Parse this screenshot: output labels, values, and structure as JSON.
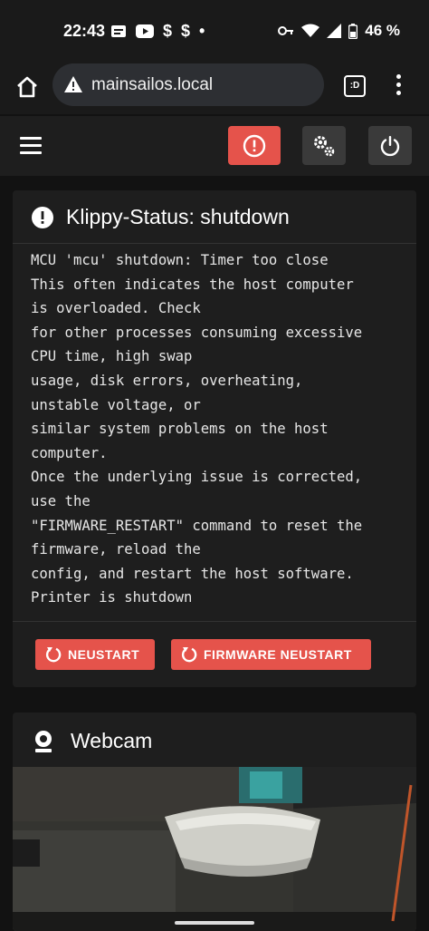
{
  "statusbar": {
    "time": "22:43",
    "battery": "46 %",
    "dollar1": "$",
    "dollar2": "$",
    "dot": "•"
  },
  "browser": {
    "url": "mainsailos.local",
    "tabs_label": ":D"
  },
  "klippy": {
    "title": "Klippy-Status: shutdown",
    "message_lines": [
      "MCU 'mcu' shutdown: Timer too close",
      "This often indicates the host computer",
      "is overloaded. Check",
      "for other processes consuming excessive",
      "CPU time, high swap",
      "usage, disk errors, overheating,",
      "unstable voltage, or",
      "similar system problems on the host",
      "computer.",
      "Once the underlying issue is corrected,",
      "use the",
      "\"FIRMWARE_RESTART\" command to reset the",
      "firmware, reload the",
      "config, and restart the host software.",
      "Printer is shutdown"
    ],
    "btn_restart": "NEUSTART",
    "btn_firmware_restart": "FIRMWARE NEUSTART"
  },
  "webcam": {
    "title": "Webcam"
  },
  "colors": {
    "accent_red": "#e5534b",
    "card_bg": "#1e1e1e",
    "page_bg": "#121212"
  }
}
